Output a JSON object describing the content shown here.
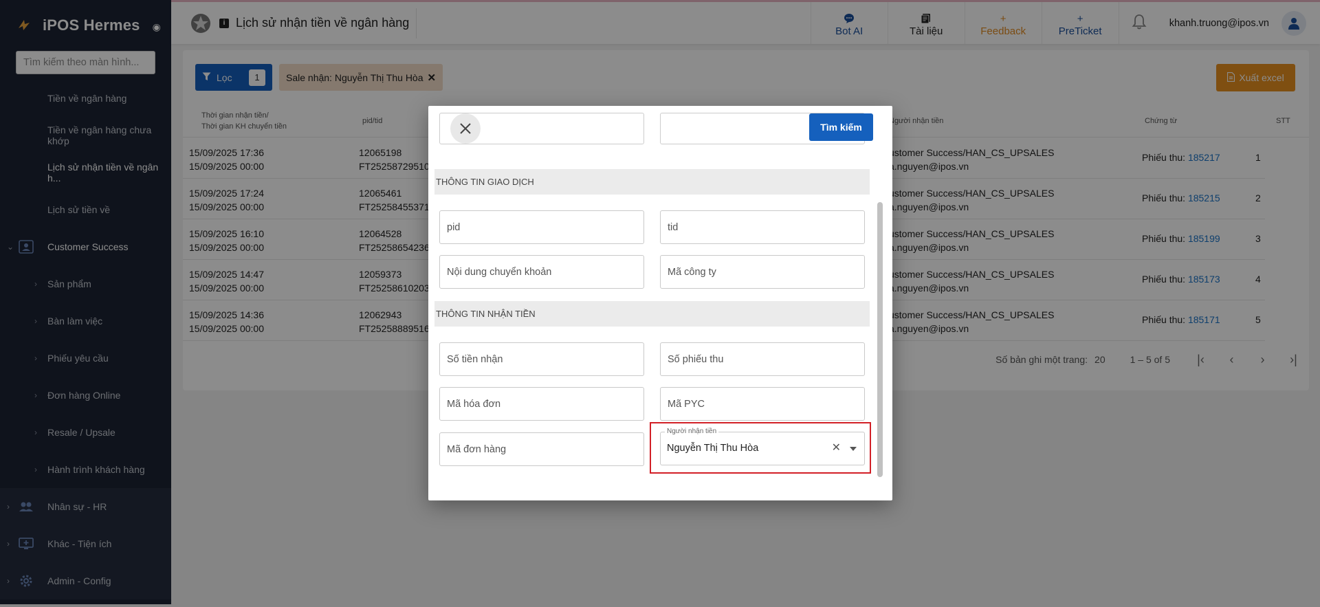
{
  "app": {
    "name": "iPOS Hermes"
  },
  "sidebar": {
    "search_placeholder": "Tìm kiếm theo màn hình...",
    "items": [
      {
        "label": "Tiền về ngân hàng"
      },
      {
        "label": "Tiền về ngân hàng chưa khớp"
      },
      {
        "label": "Lịch sử nhận tiền về ngân h..."
      },
      {
        "label": "Lịch sử tiền về"
      },
      {
        "label": "Customer Success"
      },
      {
        "label": "Sản phẩm"
      },
      {
        "label": "Bàn làm việc"
      },
      {
        "label": "Phiếu yêu cầu"
      },
      {
        "label": "Đơn hàng Online"
      },
      {
        "label": "Resale / Upsale"
      },
      {
        "label": "Hành trình khách hàng"
      },
      {
        "label": "Nhân sự - HR"
      },
      {
        "label": "Khác - Tiện ích"
      },
      {
        "label": "Admin - Config"
      }
    ]
  },
  "header": {
    "title": "Lịch sử nhận tiền về ngân hàng",
    "actions": {
      "bot_ai": "Bot AI",
      "docs": "Tài liệu",
      "feedback": "Feedback",
      "preticket": "PreTicket"
    },
    "user_email": "khanh.truong@ipos.vn"
  },
  "toolbar": {
    "filter_label": "Lọc",
    "filter_count": "1",
    "chip_label": "Sale nhận: Nguyễn Thị Thu Hòa",
    "export_label": "Xuất excel"
  },
  "table": {
    "headers": {
      "time_line1": "Thời gian nhận tiền/",
      "time_line2": "Thời gian KH chuyển tiền",
      "pid": "pid/tid",
      "receiver": "Người nhận tiền",
      "voucher": "Chứng từ",
      "stt": "STT"
    },
    "voucher_prefix": "Phiếu thu: ",
    "rows": [
      {
        "t1": "15/09/2025 17:36",
        "t2": "15/09/2025 00:00",
        "pid": "12065198",
        "tid": "FT25258729510€",
        "rcv1": "ustomer Success/HAN_CS_UPSALES",
        "rcv2": "a.nguyen@ipos.vn",
        "voucher": "185217",
        "stt": "1"
      },
      {
        "t1": "15/09/2025 17:24",
        "t2": "15/09/2025 00:00",
        "pid": "12065461",
        "tid": "FT25258455371€",
        "rcv1": "ustomer Success/HAN_CS_UPSALES",
        "rcv2": "a.nguyen@ipos.vn",
        "voucher": "185215",
        "stt": "2"
      },
      {
        "t1": "15/09/2025 16:10",
        "t2": "15/09/2025 00:00",
        "pid": "12064528",
        "tid": "FT25258654236",
        "rcv1": "ustomer Success/HAN_CS_UPSALES",
        "rcv2": "a.nguyen@ipos.vn",
        "voucher": "185199",
        "stt": "3"
      },
      {
        "t1": "15/09/2025 14:47",
        "t2": "15/09/2025 00:00",
        "pid": "12059373",
        "tid": "FT25258610203",
        "rcv1": "ustomer Success/HAN_CS_UPSALES",
        "rcv2": "a.nguyen@ipos.vn",
        "voucher": "185173",
        "stt": "4"
      },
      {
        "t1": "15/09/2025 14:36",
        "t2": "15/09/2025 00:00",
        "pid": "12062943",
        "tid": "FT25258889516",
        "rcv1": "ustomer Success/HAN_CS_UPSALES",
        "rcv2": "a.nguyen@ipos.vn",
        "voucher": "185171",
        "stt": "5"
      }
    ]
  },
  "pagination": {
    "per_page_label": "Số bản ghi một trang:",
    "per_page_value": "20",
    "range": "1 – 5 of 5"
  },
  "modal": {
    "search_button": "Tìm kiếm",
    "section_transaction": "THÔNG TIN GIAO DỊCH",
    "section_receipt": "THÔNG TIN NHẬN TIỀN",
    "fields": {
      "pid": "pid",
      "tid": "tid",
      "transfer_content": "Nội dung chuyển khoản",
      "company_code": "Mã công ty",
      "amount": "Số tiền nhận",
      "receipt_no": "Số phiếu thu",
      "invoice_code": "Mã hóa đơn",
      "pyc_code": "Mã PYC",
      "order_code": "Mã đơn hàng"
    },
    "receiver_select": {
      "label": "Người nhận tiền",
      "value": "Nguyễn Thị Thu Hòa"
    }
  }
}
